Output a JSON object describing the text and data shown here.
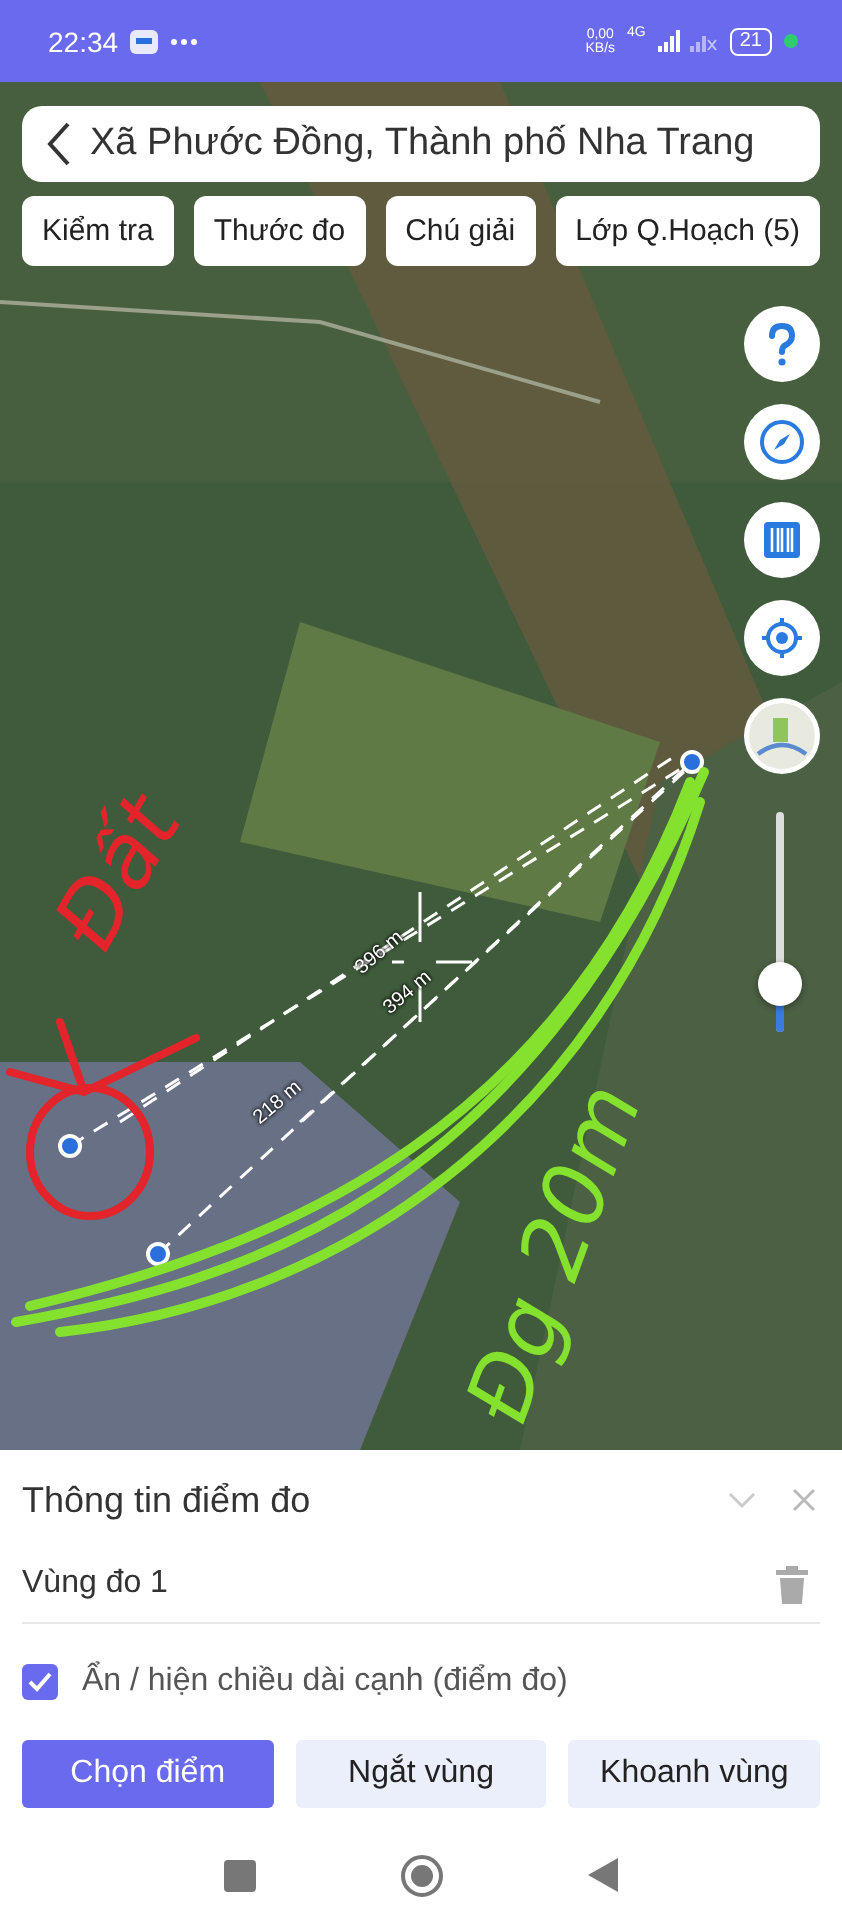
{
  "status_bar": {
    "time": "22:34",
    "net_speed": "0,00",
    "net_unit": "KB/s",
    "network": "4G",
    "battery": "21"
  },
  "search": {
    "value": "Xã Phước Đồng, Thành phố Nha Trang"
  },
  "chips": [
    {
      "label": "Kiểm tra"
    },
    {
      "label": "Thước đo"
    },
    {
      "label": "Chú giải"
    },
    {
      "label": "Lớp Q.Hoạch (5)"
    }
  ],
  "map": {
    "measurements": [
      {
        "text": "396 m"
      },
      {
        "text": "394 m"
      },
      {
        "text": "218 m"
      }
    ],
    "annotations": [
      {
        "text": "Đất",
        "color": "#e3242b"
      },
      {
        "text": "Đg 20m",
        "color": "#84e12d"
      }
    ],
    "zoom": {
      "level": 0.22
    }
  },
  "panel": {
    "title": "Thông tin điểm đo",
    "region": "Vùng đo 1",
    "toggle": {
      "label": "Ẩn / hiện chiều dài cạnh (điểm đo)",
      "checked": true
    },
    "buttons": [
      {
        "label": "Chọn điểm",
        "selected": true
      },
      {
        "label": "Ngắt vùng",
        "selected": false
      },
      {
        "label": "Khoanh vùng",
        "selected": false
      }
    ]
  }
}
